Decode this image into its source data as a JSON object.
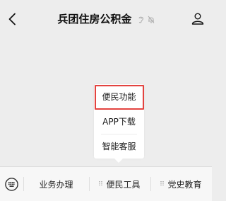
{
  "header": {
    "title": "兵团住房公积金",
    "back_icon": "chevron-left-icon",
    "status_icons": [
      "ear-icon",
      "mute-bell-icon"
    ],
    "profile_icon": "person-icon"
  },
  "popup": {
    "items": [
      {
        "label": "便民功能",
        "highlighted": true
      },
      {
        "label": "APP下载",
        "highlighted": false
      },
      {
        "label": "智能客服",
        "highlighted": false
      }
    ],
    "highlight_color": "#e3433f"
  },
  "menu": {
    "keyboard_icon": "keyboard-icon",
    "items": [
      {
        "label": "业务办理",
        "has_submenu": false
      },
      {
        "label": "便民工具",
        "has_submenu": true
      },
      {
        "label": "党史教育",
        "has_submenu": true
      }
    ]
  },
  "colors": {
    "background": "#ededed",
    "menubar": "#f7f7f7",
    "highlight": "#e3433f"
  }
}
